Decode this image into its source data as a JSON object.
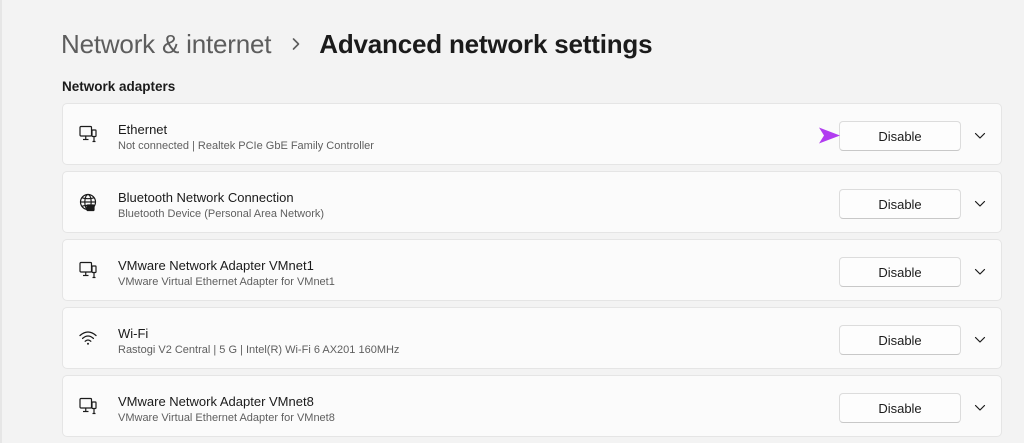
{
  "breadcrumb": {
    "parent": "Network & internet",
    "current": "Advanced network settings"
  },
  "section_title": "Network adapters",
  "adapters": [
    {
      "name": "Ethernet",
      "description": "Not connected | Realtek PCIe GbE Family Controller",
      "icon": "ethernet-icon",
      "button_label": "Disable"
    },
    {
      "name": "Bluetooth Network Connection",
      "description": "Bluetooth Device (Personal Area Network)",
      "icon": "globe-network-icon",
      "button_label": "Disable"
    },
    {
      "name": "VMware Network Adapter VMnet1",
      "description": "VMware Virtual Ethernet Adapter for VMnet1",
      "icon": "ethernet-icon",
      "button_label": "Disable"
    },
    {
      "name": "Wi-Fi",
      "description": "Rastogi V2 Central |  5 G | Intel(R) Wi-Fi 6 AX201 160MHz",
      "icon": "wifi-icon",
      "button_label": "Disable"
    },
    {
      "name": "VMware Network Adapter VMnet8",
      "description": "VMware Virtual Ethernet Adapter for VMnet8",
      "icon": "ethernet-icon",
      "button_label": "Disable"
    }
  ],
  "colors": {
    "background": "#f3f3f3",
    "card": "#fbfbfb",
    "annotation_arrow": "#b13cf0"
  }
}
